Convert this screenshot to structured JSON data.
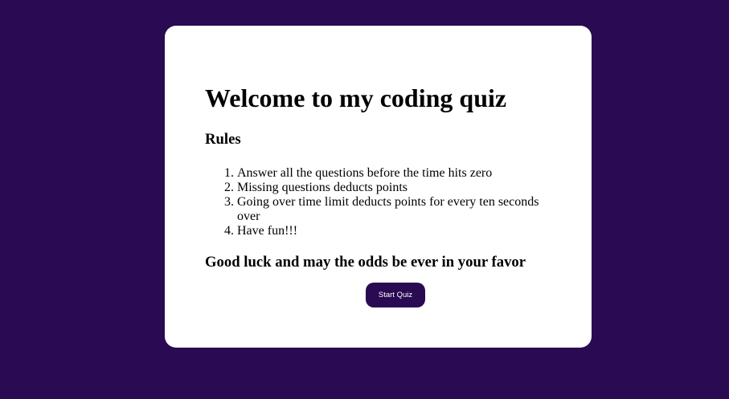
{
  "colors": {
    "background": "#2a0a52",
    "card": "#ffffff",
    "button": "#2a0a52",
    "button_text": "#ffffff"
  },
  "quiz": {
    "title": "Welcome to my coding quiz",
    "rules_heading": "Rules",
    "rules": [
      "Answer all the questions before the time hits zero",
      "Missing questions deducts points",
      "Going over time limit deducts points for every ten seconds over",
      "Have fun!!!"
    ],
    "farewell": "Good luck and may the odds be ever in your favor",
    "start_button_label": "Start Quiz"
  }
}
